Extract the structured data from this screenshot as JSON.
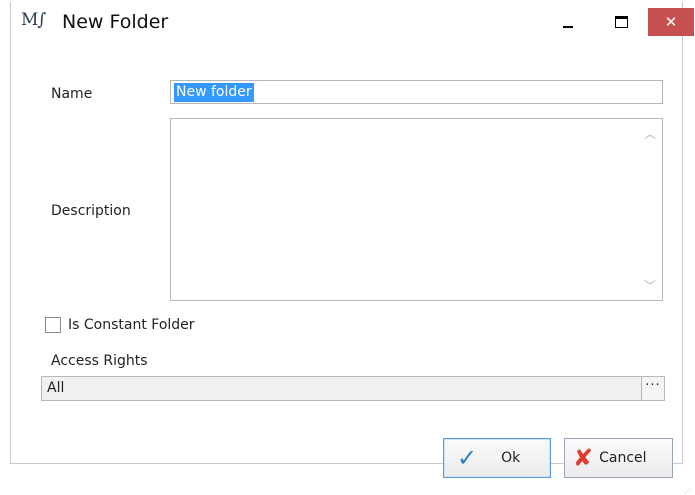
{
  "window": {
    "logo": "M∫",
    "title": "New Folder",
    "controls": {
      "minimize": "–",
      "maximize": "□",
      "close": "✕"
    }
  },
  "form": {
    "name_label": "Name",
    "name_value": "New folder",
    "description_label": "Description",
    "description_value": "",
    "constant_label": "Is Constant Folder",
    "constant_checked": false,
    "access_label": "Access Rights",
    "access_value": "All",
    "access_browse": "···"
  },
  "buttons": {
    "ok_label": "Ok",
    "cancel_label": "Cancel"
  },
  "icons": {
    "ok": "check-icon",
    "cancel": "red-x-icon"
  },
  "colors": {
    "selection": "#3399ff",
    "close_button": "#c75050",
    "ok_border": "#5b9bd5",
    "cancel_icon": "#e03a2e"
  }
}
